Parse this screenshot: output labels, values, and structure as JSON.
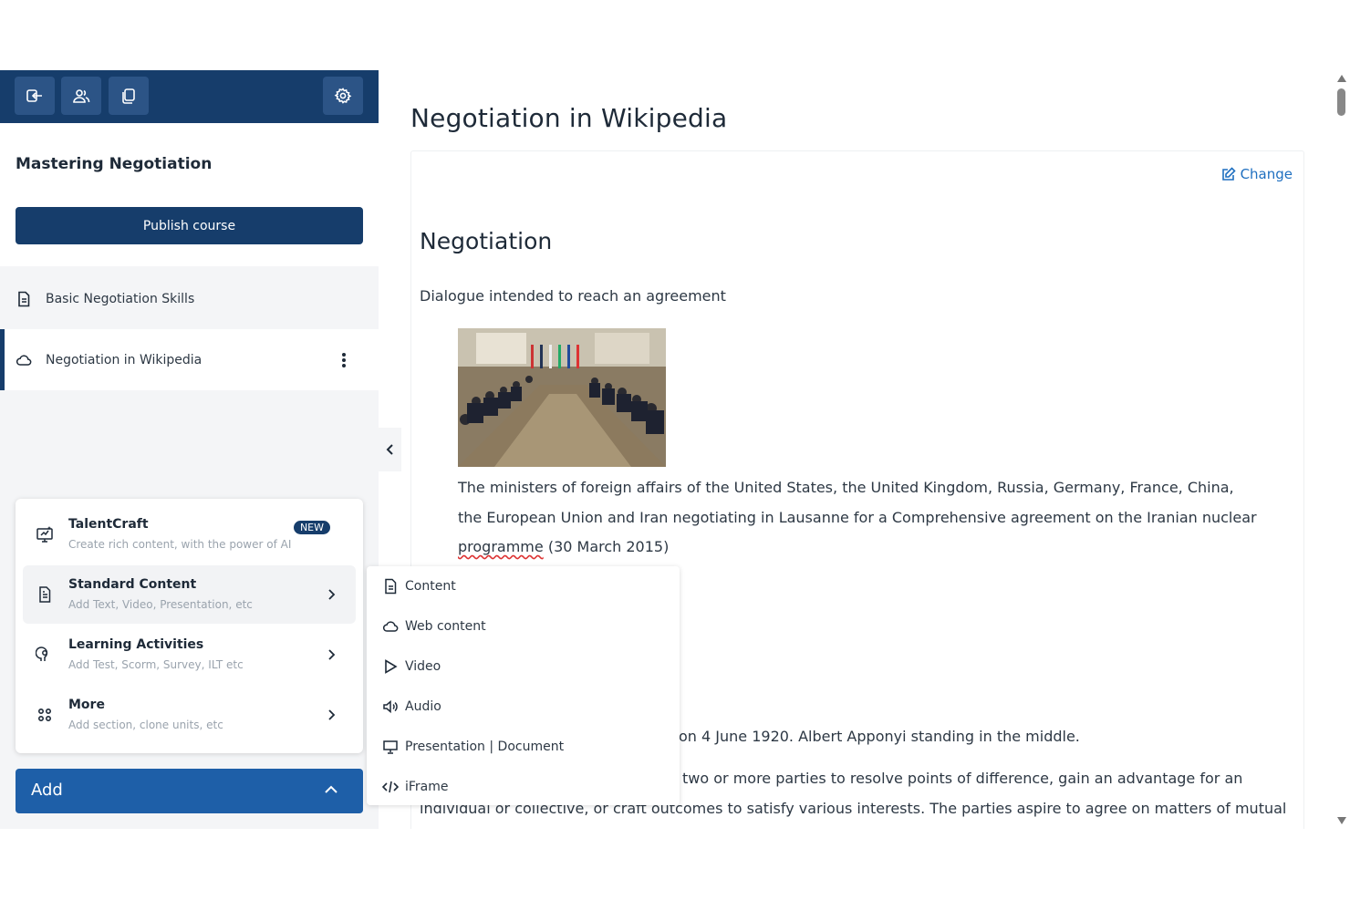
{
  "sidebar": {
    "toolbar": {
      "exit_icon": "exit-icon",
      "users_icon": "users-icon",
      "copy_icon": "copy-icon",
      "settings_icon": "gear-icon"
    },
    "course_title": "Mastering Negotiation",
    "publish_label": "Publish course",
    "units": [
      {
        "label": "Basic Negotiation Skills",
        "icon": "document-icon"
      },
      {
        "label": "Negotiation in Wikipedia",
        "icon": "cloud-icon",
        "selected": true
      }
    ],
    "add_menu": {
      "items": [
        {
          "title": "TalentCraft",
          "subtitle": "Create rich content, with the power of AI",
          "badge": "NEW",
          "icon": "ai-monitor-icon"
        },
        {
          "title": "Standard Content",
          "subtitle": "Add Text, Video, Presentation, etc",
          "icon": "document-icon"
        },
        {
          "title": "Learning Activities",
          "subtitle": "Add Test, Scorm, Survey, ILT etc",
          "icon": "activity-icon"
        },
        {
          "title": "More",
          "subtitle": "Add section, clone units, etc",
          "icon": "grid-icon"
        }
      ]
    },
    "add_label": "Add"
  },
  "submenu": {
    "items": [
      {
        "label": "Content",
        "icon": "document-icon"
      },
      {
        "label": "Web content",
        "icon": "cloud-icon"
      },
      {
        "label": "Video",
        "icon": "play-icon"
      },
      {
        "label": "Audio",
        "icon": "speaker-icon"
      },
      {
        "label": "Presentation | Document",
        "icon": "presentation-icon"
      },
      {
        "label": "iFrame",
        "icon": "code-icon"
      }
    ]
  },
  "main": {
    "page_title": "Negotiation in Wikipedia",
    "change_label": "Change",
    "content_title": "Negotiation",
    "content_desc": "Dialogue intended to reach an agreement",
    "caption": {
      "before": "The ministers of foreign affairs of the United States, the United Kingdom, Russia, Germany, France, China, the European Union and Iran negotiating in Lausanne for a Comprehensive agreement on the Iranian nuclear ",
      "misspelled": "programme",
      "after": " (30 March 2015)"
    },
    "caption2": "on 4 June 1920. Albert Apponyi standing in the middle.",
    "paragraph_line1": "two or more parties to resolve points of difference, gain an advantage for an",
    "paragraph_line2": "individual or collective, or craft outcomes to satisfy various interests. The parties aspire to agree on matters of mutual"
  },
  "colors": {
    "brand": "#163d6b",
    "add_button": "#1e5fa8",
    "link": "#1e6fc0"
  }
}
